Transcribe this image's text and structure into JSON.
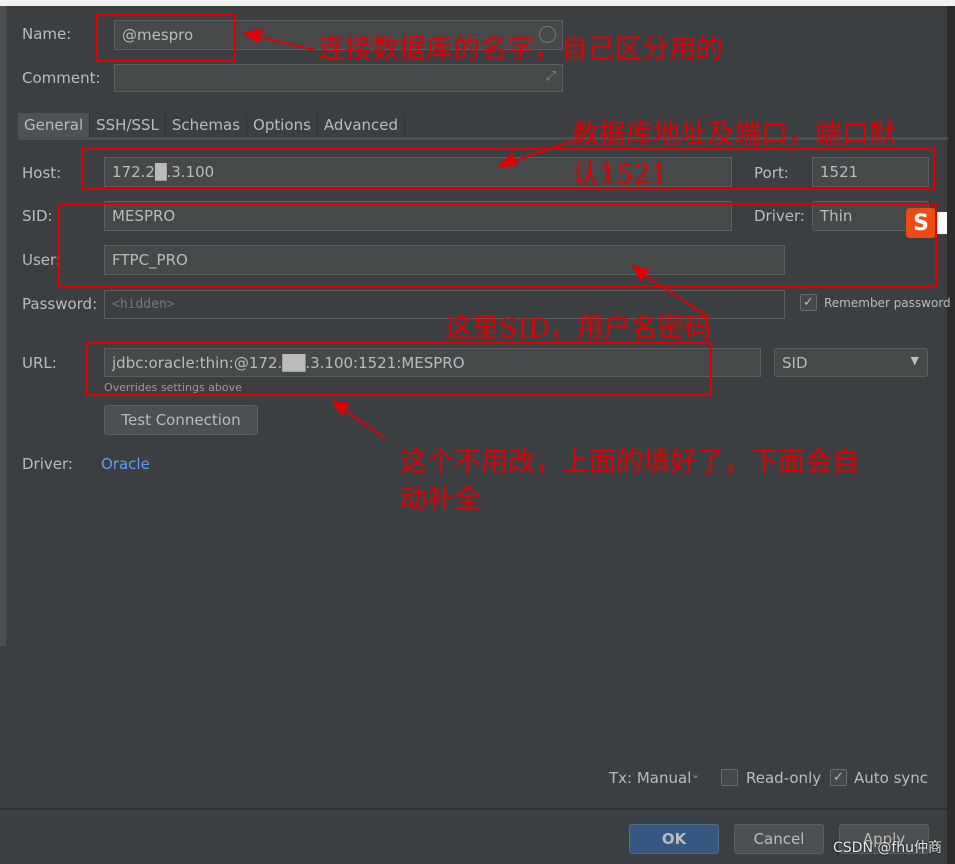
{
  "form": {
    "name_label": "Name:",
    "name_value": "@mespro",
    "comment_label": "Comment:",
    "comment_value": "",
    "tabs": [
      {
        "label": "General",
        "active": true
      },
      {
        "label": "SSH/SSL"
      },
      {
        "label": "Schemas"
      },
      {
        "label": "Options"
      },
      {
        "label": "Advanced"
      }
    ],
    "host_label": "Host:",
    "host_value": "172.2█.3.100",
    "port_label": "Port:",
    "port_value": "1521",
    "sid_label": "SID:",
    "sid_value": "MESPRO",
    "driver_label": "Driver:",
    "driver_value": "Thin",
    "user_label": "User:",
    "user_value": "FTPC_PRO",
    "password_label": "Password:",
    "password_placeholder": "<hidden>",
    "remember_password_label": "Remember password",
    "remember_password_checked": true,
    "url_label": "URL:",
    "url_value": "jdbc:oracle:thin:@172.██.3.100:1521:MESPRO",
    "url_hint": "Overrides settings above",
    "url_type": "SID",
    "test_connection_label": "Test Connection",
    "driver_link_label": "Driver:",
    "driver_link": "Oracle"
  },
  "footer": {
    "tx_label": "Tx: Manual",
    "readonly_label": "Read-only",
    "readonly_checked": false,
    "autosync_label": "Auto sync",
    "autosync_checked": true,
    "ok": "OK",
    "cancel": "Cancel",
    "apply": "Apply"
  },
  "annotations": {
    "name_note": "连接数据库的名字，自己区分用的",
    "host_note_1": "数据库地址及端口，端口默",
    "host_note_2": "认1521",
    "sid_note": "这里SID，用户名密码",
    "url_note_1": "这个不用改，上面的填好了，下面会自",
    "url_note_2": "动补全"
  },
  "watermark": "CSDN @fhu仲商",
  "colors": {
    "background": "#3c3f41",
    "accent": "#365880",
    "annotation": "#e00000",
    "link": "#589df6"
  }
}
